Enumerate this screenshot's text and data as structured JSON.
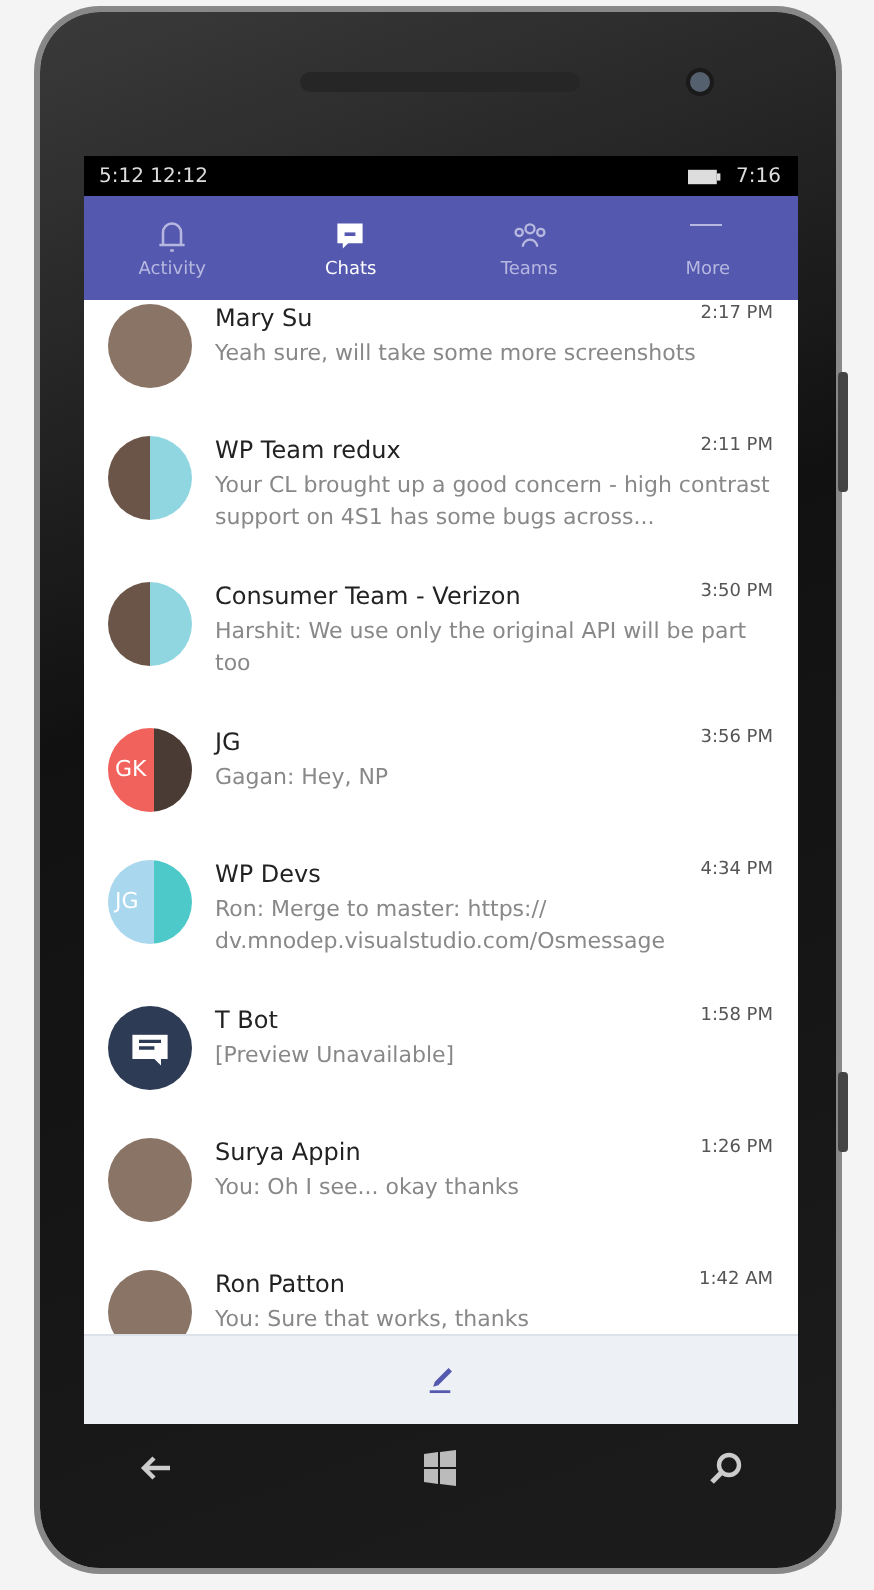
{
  "status_bar": {
    "left": "5:12 12:12",
    "right": "7:16"
  },
  "tabs": [
    {
      "label": "Activity",
      "selected": false
    },
    {
      "label": "Chats",
      "selected": true
    },
    {
      "label": "Teams",
      "selected": false
    },
    {
      "label": "More",
      "selected": false
    }
  ],
  "chats": [
    {
      "name": "Mary Su",
      "time": "2:17 PM",
      "preview": "Yeah sure, will take some more screenshots",
      "avatar": {
        "kind": "photo"
      }
    },
    {
      "name": "WP Team redux",
      "time": "2:11 PM",
      "preview": "Your CL brought up a good concern - high contrast support on 4S1 has some bugs across...",
      "avatar": {
        "kind": "group"
      }
    },
    {
      "name": "Consumer Team - Verizon",
      "time": "3:50 PM",
      "preview": "Harshit: We use only the original API will be part too",
      "avatar": {
        "kind": "group"
      }
    },
    {
      "name": "JG",
      "time": "3:56 PM",
      "preview": "Gagan: Hey, NP",
      "avatar": {
        "kind": "initials",
        "initials": "GK"
      }
    },
    {
      "name": "WP Devs",
      "time": "4:34 PM",
      "preview": "Ron: Merge to master: https:// dv.mnodep.visualstudio.com/Osmessage",
      "avatar": {
        "kind": "initials",
        "initials": "JG"
      }
    },
    {
      "name": "T Bot",
      "time": "1:58 PM",
      "preview": "[Preview Unavailable]",
      "avatar": {
        "kind": "bot"
      }
    },
    {
      "name": "Surya Appin",
      "time": "1:26 PM",
      "preview": "You: Oh I see... okay thanks",
      "avatar": {
        "kind": "photo"
      }
    },
    {
      "name": "Ron Patton",
      "time": "1:42 AM",
      "preview": "You: Sure that works, thanks",
      "avatar": {
        "kind": "photo"
      }
    }
  ]
}
